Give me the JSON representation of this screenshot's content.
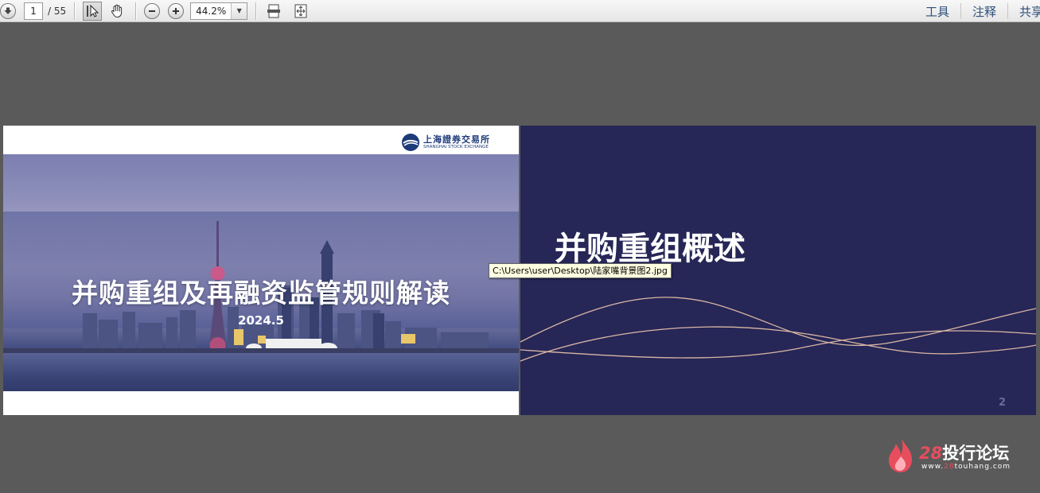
{
  "toolbar": {
    "page_current": "1",
    "page_total": "/ 55",
    "zoom": "44.2%",
    "menu": {
      "tools": "工具",
      "comment": "注释",
      "share": "共享"
    }
  },
  "slide1": {
    "title": "并购重组及再融资监管规则解读",
    "date": "2024.5",
    "logo_cn": "上海證券交易所",
    "logo_en": "SHANGHAI STOCK EXCHANGE"
  },
  "slide2": {
    "title": "并购重组概述",
    "page_number": "2"
  },
  "tooltip": {
    "text": "C:\\Users\\user\\Desktop\\陆家嘴背景图2.jpg"
  },
  "watermark": {
    "number": "28",
    "name": "投行论坛",
    "url_prefix": "www.",
    "url_highlight": "28",
    "url_suffix": "touhang.com"
  },
  "colors": {
    "canvas_bg": "#5a5a5a",
    "slide2_bg": "#262657",
    "menu_text": "#2f4f7a",
    "wave_line": "#d9b6a3",
    "watermark_accent": "#e84d5e"
  }
}
